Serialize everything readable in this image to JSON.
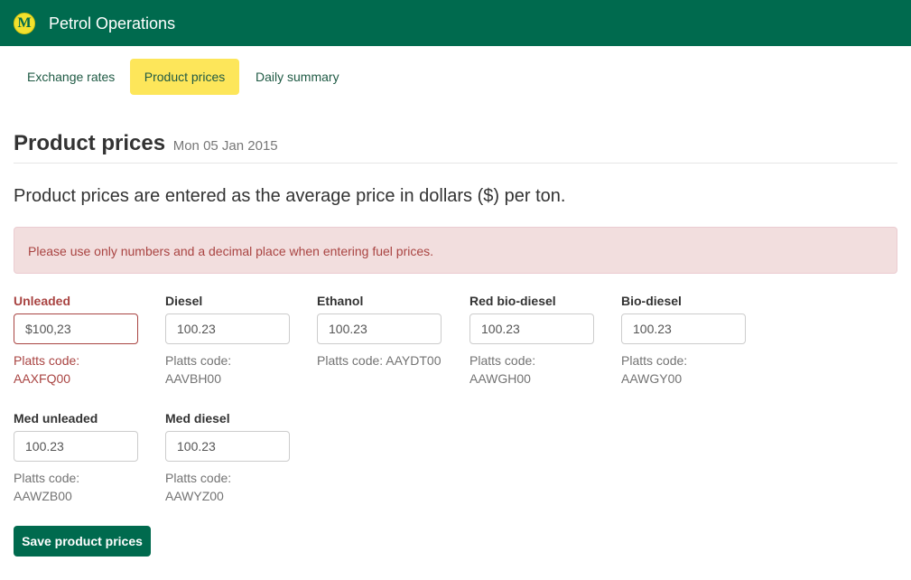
{
  "header": {
    "logo_letter": "M",
    "app_title": "Petrol Operations"
  },
  "tabs": [
    {
      "label": "Exchange rates"
    },
    {
      "label": "Product prices"
    },
    {
      "label": "Daily summary"
    }
  ],
  "page": {
    "title": "Product prices",
    "date": "Mon 05 Jan 2015"
  },
  "lead": "Product prices are entered as the average price in dollars ($) per ton.",
  "alert": "Please use only numbers and a decimal place when entering fuel prices.",
  "fields": [
    {
      "label": "Unleaded",
      "value": "$100,23",
      "hint": "Platts code: AAXFQ00",
      "error": true
    },
    {
      "label": "Diesel",
      "value": "100.23",
      "hint": "Platts code: AAVBH00"
    },
    {
      "label": "Ethanol",
      "value": "100.23",
      "hint": "Platts code: AAYDT00"
    },
    {
      "label": "Red bio-diesel",
      "value": "100.23",
      "hint": "Platts code: AAWGH00"
    },
    {
      "label": "Bio-diesel",
      "value": "100.23",
      "hint": "Platts code: AAWGY00"
    },
    {
      "label": "Med unleaded",
      "value": "100.23",
      "hint": "Platts code: AAWZB00"
    },
    {
      "label": "Med diesel",
      "value": "100.23",
      "hint": "Platts code: AAWYZ00"
    }
  ],
  "save_label": "Save product prices",
  "colors": {
    "brand_green": "#006a4e",
    "active_tab": "#fde65a",
    "error": "#a94442",
    "alert_bg": "#f2dede"
  }
}
